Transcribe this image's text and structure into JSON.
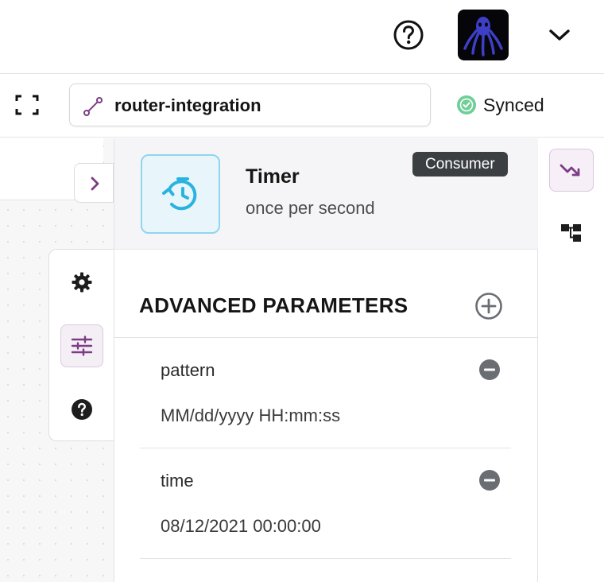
{
  "header": {
    "help_icon": "question-circle-icon",
    "avatar_icon": "kaoto-octopus-logo",
    "menu_icon": "chevron-down-icon"
  },
  "toolbar": {
    "expand_icon": "expand-icon",
    "route_icon": "route-icon",
    "integration_name": "router-integration",
    "sync_status": "Synced",
    "sync_icon": "check-circle-icon",
    "sync_color": "#6fcf97"
  },
  "canvas": {
    "collapse_icon": "chevron-right-icon"
  },
  "side_tabs": [
    {
      "icon": "gear-icon",
      "active": false
    },
    {
      "icon": "sliders-icon",
      "active": true
    },
    {
      "icon": "question-circle-icon",
      "active": false
    }
  ],
  "step": {
    "title": "Timer",
    "description": "once per second",
    "kind": "Consumer",
    "icon": "timer-icon",
    "icon_color": "#2bb3e0"
  },
  "advanced": {
    "title": "ADVANCED PARAMETERS",
    "add_icon": "plus-circle-icon",
    "params": [
      {
        "name": "pattern",
        "value": "MM/dd/yyyy HH:mm:ss",
        "remove_icon": "minus-circle-icon"
      },
      {
        "name": "time",
        "value": "08/12/2021 00:00:00",
        "remove_icon": "minus-circle-icon"
      }
    ]
  },
  "rail": [
    {
      "icon": "trend-down-icon",
      "active": true
    },
    {
      "icon": "hierarchy-icon",
      "active": false
    }
  ],
  "colors": {
    "accent": "#7c3d84",
    "badge_bg": "#3c3f42",
    "timer_bg": "#e8f6fc"
  }
}
